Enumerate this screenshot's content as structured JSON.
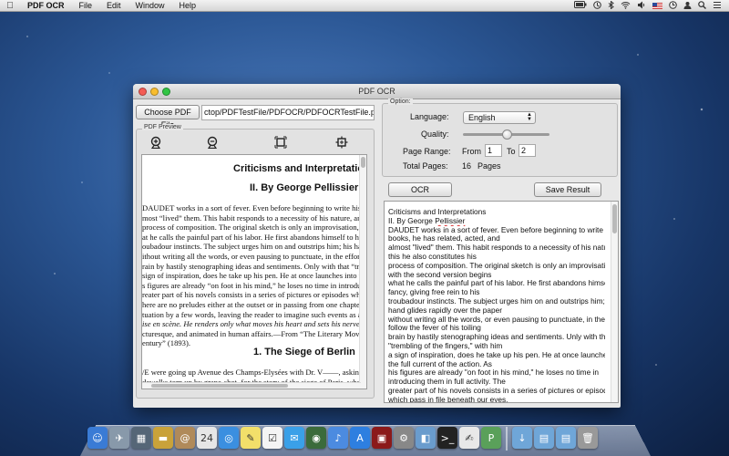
{
  "menubar": {
    "app_name": "PDF OCR",
    "items": [
      "File",
      "Edit",
      "Window",
      "Help"
    ]
  },
  "window": {
    "title": "PDF OCR",
    "choose_button": "Choose PDF File",
    "path": "ctop/PDFTestFile/PDFOCR/PDFOCRTestFile.pdf",
    "preview_label": "PDF Preview",
    "preview_tools": [
      "zoom-in-icon",
      "zoom-out-icon",
      "fit-page-icon",
      "fit-width-icon"
    ],
    "options": {
      "label": "Option:",
      "language_label": "Language:",
      "language_value": "English",
      "quality_label": "Quality:",
      "quality_level": 0.5,
      "page_range_label": "Page Range:",
      "from_label": "From",
      "from_value": "1",
      "to_label": "To",
      "to_value": "2",
      "total_pages_label": "Total Pages:",
      "total_pages_value": "16",
      "pages_suffix": "Pages"
    },
    "ocr_button": "OCR",
    "save_button": "Save Result"
  },
  "pdf_page": {
    "heading1": "Criticisms and Interpretatio",
    "heading2": "II. By George Pellissier",
    "body1": [
      "DAUDET works in a sort of fever. Even before beginning to write his b",
      "most “lived” them. This habit responds to a necessity of his nature, an",
      "process of composition. The original sketch is only an improvisation, bu",
      "at he calls the painful part of his labor. He first abandons himself to his f",
      "oubadour instincts. The subject urges him on and outstrips him; his hand",
      "ithout writing all the words, or even pausing to punctuate, in the effort",
      "rain by hastily stenographing ideas and sentiments. Only with that “tre",
      "sign of inspiration, does he take up his pen. He at once launches into t",
      "s figures are already “on foot in his mind,” he loses no time in introdu",
      "reater part of his novels consists in a series of pictures or episodes whi",
      "here are no preludes either at the outset or in passing from one chapter",
      "tuation by a few words, leaving the reader to imagine such events as are no",
      "ise en scène. He renders only what moves his heart and sets his nerves",
      "cturesque, and animated in human affairs.—From “The Literary Move",
      "entury” (1893)."
    ],
    "heading3": "1. The Siege of Berlin",
    "body2": [
      "/E were going up Avenue des Champs-Elysées with Dr. V——, askin",
      "dewalks torn up by grape-shot, for the story of the siege of Paris, whe"
    ]
  },
  "result_lines": [
    "Criticisms and Interpretations",
    "II. By George Pellissier",
    "DAUDET works in a sort of fever. Even before beginning to write his",
    "books, he has related, acted, and",
    "almost \"lived\" them. This habit responds to a necessity of his nature, and",
    "this he also constitutes his",
    "process of composition. The original sketch is only an improvisation, but",
    "with the second version begins",
    "what he calls the painful part of his labor. He first abandons himself to his",
    "fancy, giving free rein to his",
    "troubadour instincts. The subject urges him on and outstrips him; his",
    "hand glides rapidly over the paper",
    "without writing all the words, or even pausing to punctuate, in the effort to",
    "follow the fever of his toiling",
    "brain by hastily stenographing ideas and sentiments. Unly with that",
    "\"trembling of the fingers,\" with him",
    "a sign of inspiration, does he take up his pen. He at once launches into",
    "the full current of the action. As",
    "his figures are already \"on foot in his mind,\" he loses no time in",
    "introducing them in full activity. The",
    "greater part of his novels consists in a series of pictures or episodes",
    "which pass in file beneath our eyes.",
    "There are no preludes either at the outset or in passing from one chapter",
    "to another; he explains the"
  ],
  "dock_icons": [
    "finder-icon",
    "launchpad-icon",
    "mission-control-icon",
    "folder-icon",
    "address-book-icon",
    "calendar-icon",
    "safari-icon",
    "notes-icon",
    "reminders-icon",
    "messages-icon",
    "facetime-icon",
    "itunes-icon",
    "app-store-icon",
    "photobooth-icon",
    "system-preferences-icon",
    "preview-icon",
    "terminal-icon",
    "textedit-icon",
    "pdf-ocr-icon",
    "downloads-folder-icon",
    "documents-folder-icon",
    "folder-icon",
    "trash-icon"
  ],
  "menubar_status_icons": [
    "wifi-icon",
    "volume-icon",
    "battery-icon",
    "flag-icon",
    "time-machine-icon",
    "clock-icon",
    "user-icon",
    "spotlight-icon",
    "notification-icon"
  ]
}
